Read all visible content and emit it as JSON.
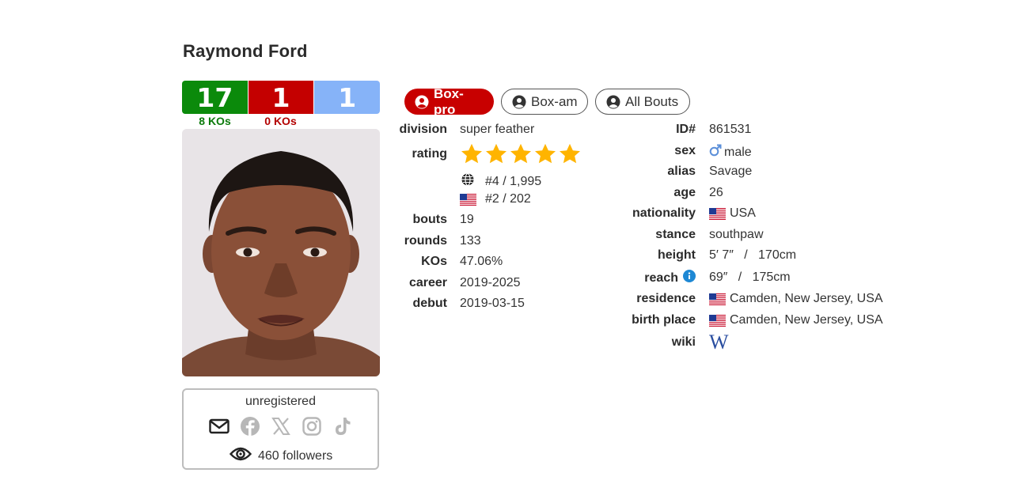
{
  "boxer": {
    "name": "Raymond Ford"
  },
  "record": {
    "wins": "17",
    "losses": "1",
    "draws": "1",
    "win_kos": "8 KOs",
    "loss_kos": "0 KOs"
  },
  "colors": {
    "win": "#0b8a0b",
    "loss": "#c40000",
    "draw": "#86b3f8",
    "active_tab": "#c80000",
    "star": "#ffb400"
  },
  "social": {
    "status": "unregistered",
    "followers": "460 followers",
    "icons": [
      "envelope-icon",
      "facebook-icon",
      "x-icon",
      "instagram-icon",
      "tiktok-icon",
      "eye-icon"
    ]
  },
  "tabs": [
    {
      "label": "Box-pro",
      "active": true
    },
    {
      "label": "Box-am",
      "active": false
    },
    {
      "label": "All Bouts",
      "active": false
    }
  ],
  "details_left": {
    "division": {
      "label": "division",
      "value": "super feather"
    },
    "rating": {
      "label": "rating",
      "stars": 5,
      "world_rank": "#4 / 1,995",
      "country_rank": "#2 / 202"
    },
    "bouts": {
      "label": "bouts",
      "value": "19"
    },
    "rounds": {
      "label": "rounds",
      "value": "133"
    },
    "kos": {
      "label": "KOs",
      "value": "47.06%"
    },
    "career": {
      "label": "career",
      "value": "2019-2025"
    },
    "debut": {
      "label": "debut",
      "value": "2019-03-15"
    }
  },
  "details_right": {
    "id": {
      "label": "ID#",
      "value": "861531"
    },
    "sex": {
      "label": "sex",
      "value": "male"
    },
    "alias": {
      "label": "alias",
      "value": "Savage"
    },
    "age": {
      "label": "age",
      "value": "26"
    },
    "nationality": {
      "label": "nationality",
      "value": "USA"
    },
    "stance": {
      "label": "stance",
      "value": "southpaw"
    },
    "height": {
      "label": "height",
      "value": "5′ 7″   /   170cm"
    },
    "reach": {
      "label": "reach",
      "value": "69″   /   175cm"
    },
    "residence": {
      "label": "residence",
      "value": "Camden, New Jersey, USA"
    },
    "birth_place": {
      "label": "birth place",
      "value": "Camden, New Jersey, USA"
    },
    "wiki": {
      "label": "wiki",
      "value": "W"
    }
  }
}
